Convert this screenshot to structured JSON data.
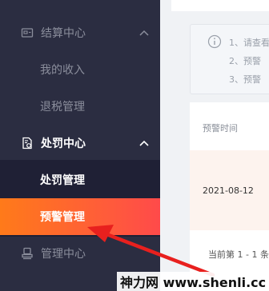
{
  "sidebar": {
    "settlement": {
      "label": "结算中心",
      "icon": "invoice-icon",
      "expanded": true
    },
    "settlement_items": [
      {
        "label": "我的收入"
      },
      {
        "label": "退税管理"
      }
    ],
    "penalty": {
      "label": "处罚中心",
      "icon": "document-gear-icon",
      "expanded": true
    },
    "penalty_items": [
      {
        "label": "处罚管理"
      },
      {
        "label": "预警管理",
        "active": true
      }
    ],
    "management": {
      "label": "管理中心",
      "icon": "stamp-icon"
    }
  },
  "notice": {
    "lines": [
      "1、请查看",
      "2、预警",
      "3、预警"
    ]
  },
  "table": {
    "header": "预警时间",
    "rows": [
      {
        "time": "2021-08-12"
      }
    ]
  },
  "pagination": {
    "text": "当前第 1 - 1 条"
  },
  "watermark": "神力网 www.shenli.cc",
  "colors": {
    "sidebar_bg": "#2b2d41",
    "submenu_bg": "#1f2035",
    "active_gradient_start": "#ff7a1a",
    "active_gradient_end": "#ff4a4a",
    "annotation_arrow": "#e8201e"
  }
}
